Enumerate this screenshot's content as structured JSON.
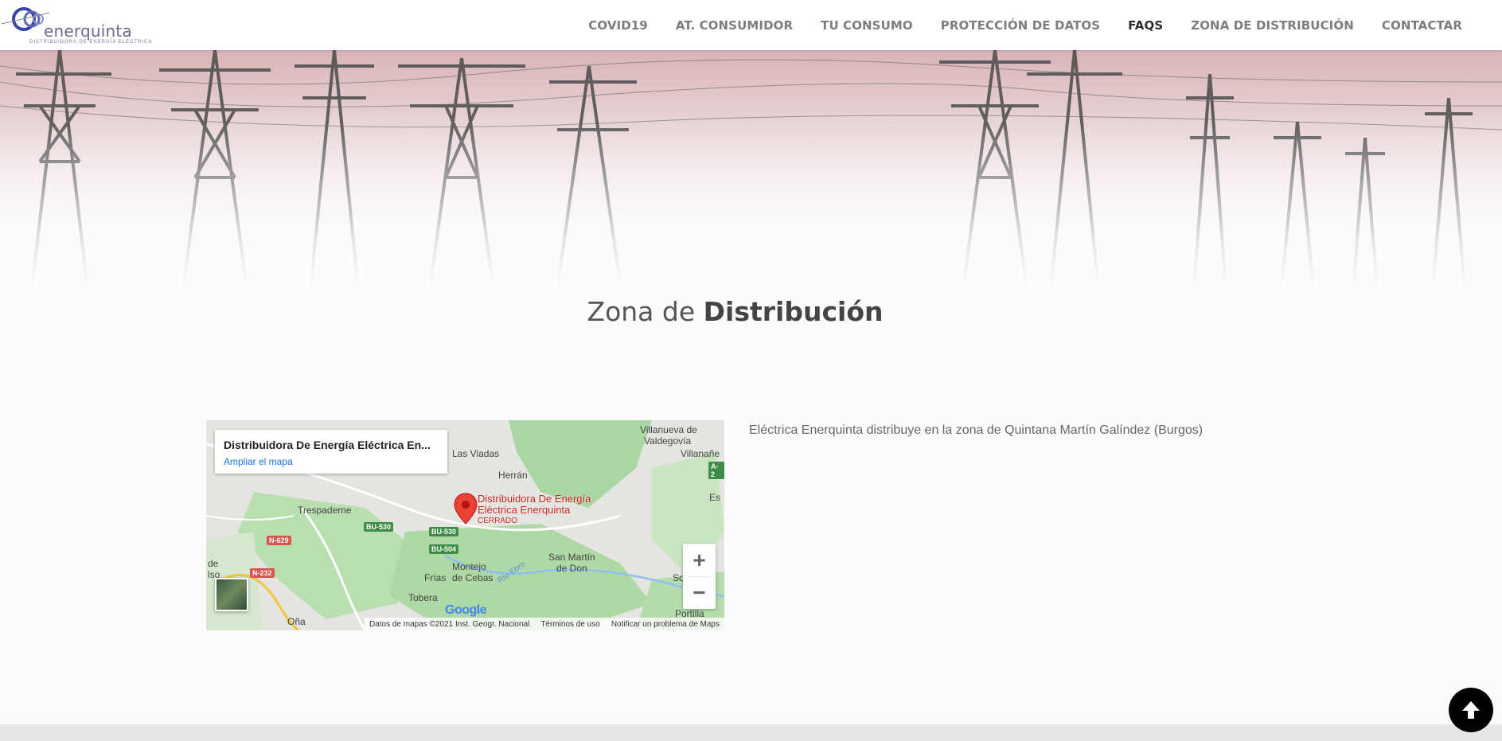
{
  "header": {
    "logo_word": "enerquinta",
    "logo_tagline": "DISTRIBUIDORA DE ENERGÍA ELÉCTRICA",
    "nav": [
      {
        "label": "COVID19",
        "active": false
      },
      {
        "label": "AT. CONSUMIDOR",
        "active": false
      },
      {
        "label": "TU CONSUMO",
        "active": false
      },
      {
        "label": "PROTECCIÓN DE DATOS",
        "active": false
      },
      {
        "label": "FAQS",
        "active": true
      },
      {
        "label": "ZONA DE DISTRIBUCIÓN",
        "active": false
      },
      {
        "label": "CONTACTAR",
        "active": false
      }
    ]
  },
  "section": {
    "title_light": "Zona de ",
    "title_bold": "Distribución",
    "description": "Eléctrica Enerquinta distribuye en la zona de Quintana Martín Galíndez (Burgos)"
  },
  "map": {
    "card_title": "Distribuidora De Energía Eléctrica En...",
    "card_link": "Ampliar el mapa",
    "pin_name_1": "Distribuidora De Energía",
    "pin_name_2": "Eléctrica Enerquinta",
    "pin_status": "CERRADO",
    "zoom_in": "+",
    "zoom_out": "−",
    "google": "Google",
    "footer_data": "Datos de mapas ©2021 Inst. Geogr. Nacional",
    "footer_terms": "Términos de uso",
    "footer_report": "Notificar un problema de Maps",
    "places": {
      "villanueva": "Villanueva de",
      "valdegovia": "Valdegovía",
      "las_viadas": "Las Viadas",
      "villanane": "Villanañe",
      "herran": "Herrán",
      "trespaderne": "Trespaderne",
      "san_martin": "San Martín",
      "de_don": "de Don",
      "montejo": "Montejo",
      "de_cebas": "de Cebas",
      "frias": "Frías",
      "tobera": "Tobera",
      "portilla": "Portilla",
      "ona": "Oña",
      "de": "de",
      "lso": "lso",
      "so": "So",
      "es": "Es",
      "rio_ebro": "Río Ebro"
    },
    "roads": {
      "bu530a": "BU-530",
      "bu530b": "BU-530",
      "bu504": "BU-504",
      "n629": "N-629",
      "n232": "N-232",
      "a2": "A-2"
    }
  },
  "colors": {
    "nav_text": "#7d7d7d",
    "nav_active": "#2e2e2e",
    "pin": "#ea4335",
    "footer_band": "#e7e7e7"
  }
}
